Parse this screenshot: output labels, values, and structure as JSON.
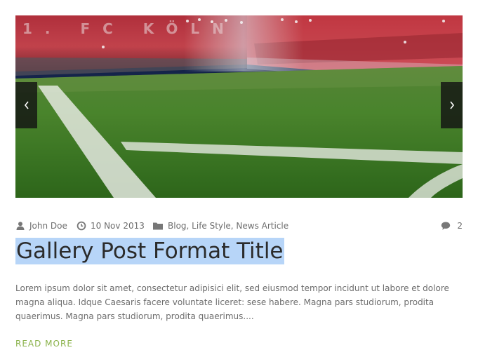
{
  "gallery": {
    "image_name": "football-stadium-corner-photo",
    "stand_lettering": "1. FC KÖLN",
    "prev_icon": "chevron-left-icon",
    "next_icon": "chevron-right-icon"
  },
  "meta": {
    "author_icon": "user-icon",
    "author": "John Doe",
    "date_icon": "clock-icon",
    "date": "10 Nov 2013",
    "categories_icon": "folder-icon",
    "categories": [
      "Blog",
      "Life Style",
      "News Article"
    ],
    "separator": ", ",
    "comments_icon": "comment-icon",
    "comments_count": "2"
  },
  "post": {
    "title": "Gallery Post Format Title",
    "excerpt": "Lorem ipsum dolor sit amet, consectetur adipisici elit, sed eiusmod tempor incidunt ut labore et dolore magna aliqua. Idque Caesaris facere voluntate liceret: sese habere. Magna pars studiorum, prodita quaerimus. Magna pars studiorum, prodita quaerimus....",
    "read_more": "READ MORE"
  },
  "colors": {
    "accent": "#8ab24a",
    "title": "#2b2b2b",
    "text": "#6d6d6d",
    "selection": "#b7d5f8",
    "arrow_bg": "#141414"
  }
}
